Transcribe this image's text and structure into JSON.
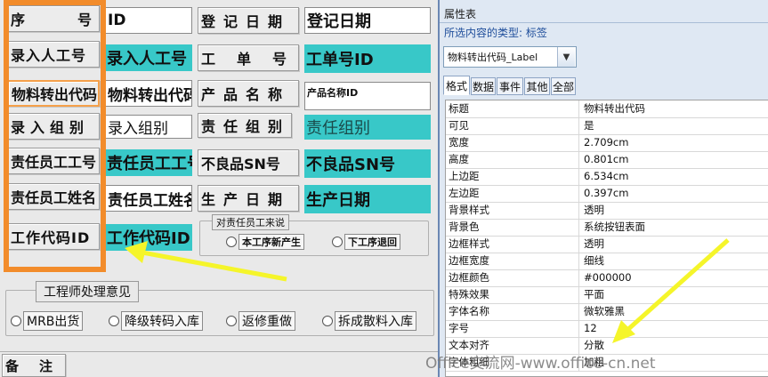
{
  "form": {
    "labels": {
      "seq": "序　　号",
      "entry_id": "录入人工号",
      "material_code": "物料转出代码",
      "entry_group": "录入组别",
      "resp_id": "责任员工工号",
      "resp_name": "责任员工姓名",
      "work_code": "工作代码ID",
      "reg_date": "登记日期",
      "order_no": "工　单　号",
      "product_name": "产品名称",
      "resp_group": "责任组别",
      "defect_sn": "不良品SN号",
      "prod_date": "生产日期",
      "remark": "备　注"
    },
    "fields": {
      "id": "ID",
      "entry_id": "录入人工号",
      "material_code": "物料转出代码",
      "entry_group": "录入组别",
      "resp_id": "责任员工工号",
      "resp_name": "责任员工姓名",
      "work_code": "工作代码ID",
      "reg_date": "登记日期",
      "order_no": "工单号ID",
      "product_name": "产品名称ID",
      "resp_group": "责任组别",
      "defect_sn": "不良品SN号",
      "prod_date": "生产日期"
    },
    "resp_group_frame": {
      "caption": "对责任员工来说",
      "options": [
        "本工序新产生",
        "下工序退回"
      ]
    },
    "engineer_frame": {
      "caption": "工程师处理意见",
      "options": [
        "MRB出货",
        "降级转码入库",
        "返修重做",
        "拆成散料入库"
      ]
    }
  },
  "property_sheet": {
    "title": "属性表",
    "selection_type": "所选内容的类型:  标签",
    "selected_control": "物料转出代码_Label",
    "tabs": [
      "格式",
      "数据",
      "事件",
      "其他",
      "全部"
    ],
    "active_tab": "格式",
    "rows": [
      {
        "key": "标题",
        "value": "物料转出代码"
      },
      {
        "key": "可见",
        "value": "是"
      },
      {
        "key": "宽度",
        "value": "2.709cm"
      },
      {
        "key": "高度",
        "value": "0.801cm"
      },
      {
        "key": "上边距",
        "value": "6.534cm"
      },
      {
        "key": "左边距",
        "value": "0.397cm"
      },
      {
        "key": "背景样式",
        "value": "透明"
      },
      {
        "key": "背景色",
        "value": "系统按钮表面"
      },
      {
        "key": "边框样式",
        "value": "透明"
      },
      {
        "key": "边框宽度",
        "value": "细线"
      },
      {
        "key": "边框颜色",
        "value": "#000000"
      },
      {
        "key": "特殊效果",
        "value": "平面"
      },
      {
        "key": "字体名称",
        "value": "微软雅黑"
      },
      {
        "key": "字号",
        "value": "12"
      },
      {
        "key": "文本对齐",
        "value": "分散"
      },
      {
        "key": "字体粗细",
        "value": "加粗"
      }
    ]
  },
  "watermark": "Office交流网-www.office-cn.net",
  "colors": {
    "highlight": "#f28c2b",
    "field_teal": "#38c8c8",
    "arrow": "#f5f52a"
  }
}
